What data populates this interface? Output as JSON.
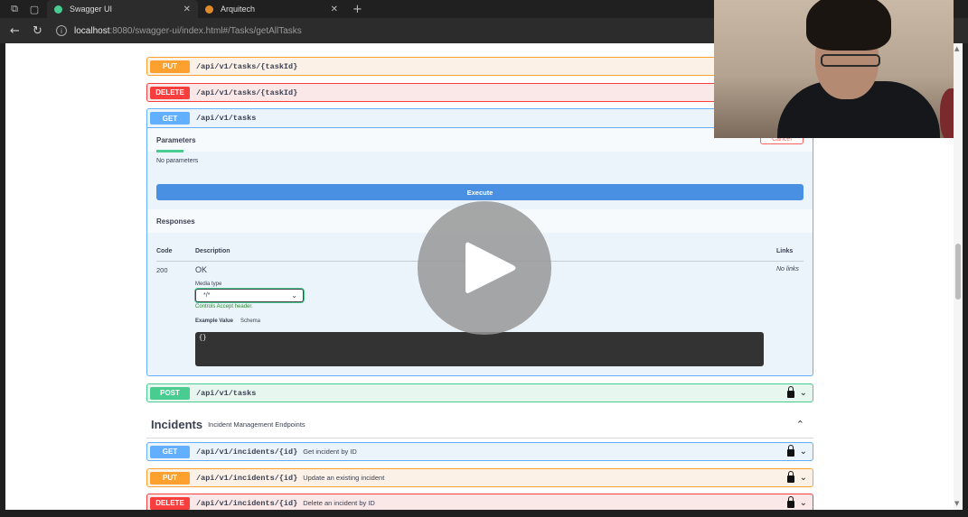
{
  "browser": {
    "tabs": [
      {
        "title": "Swagger UI",
        "active": true,
        "favicon_color": "#49cc90"
      },
      {
        "title": "Arquitech",
        "active": false,
        "favicon_color": "#e08a2a"
      }
    ],
    "url_host": "localhost",
    "url_rest": ":8080/swagger-ui/index.html#/Tasks/getAllTasks"
  },
  "operations_top": [
    {
      "method": "PUT",
      "path": "/api/v1/tasks/{taskId}"
    },
    {
      "method": "DELETE",
      "path": "/api/v1/tasks/{taskId}"
    }
  ],
  "get_expanded": {
    "method": "GET",
    "path": "/api/v1/tasks",
    "parameters_tab": "Parameters",
    "cancel_label": "Cancel",
    "no_params": "No parameters",
    "execute_label": "Execute",
    "responses_title": "Responses",
    "col_code": "Code",
    "col_description": "Description",
    "col_links": "Links",
    "response": {
      "code": "200",
      "description": "OK",
      "links": "No links",
      "media_type_label": "Media type",
      "media_type_value": "*/*",
      "controls_note": "Controls Accept header.",
      "example_value_tab": "Example Value",
      "schema_tab": "Schema",
      "example_body": "{}"
    }
  },
  "post_task": {
    "method": "POST",
    "path": "/api/v1/tasks"
  },
  "incidents": {
    "title": "Incidents",
    "description": "Incident Management Endpoints",
    "operations": [
      {
        "method": "GET",
        "path": "/api/v1/incidents/{id}",
        "summary": "Get incident by ID"
      },
      {
        "method": "PUT",
        "path": "/api/v1/incidents/{id}",
        "summary": "Update an existing incident"
      },
      {
        "method": "DELETE",
        "path": "/api/v1/incidents/{id}",
        "summary": "Delete an incident by ID"
      }
    ]
  },
  "icons": {
    "lock": "lock-icon",
    "chevron_down": "chevron-down-icon",
    "chevron_up": "chevron-up-icon",
    "play": "play-icon"
  },
  "colors": {
    "put": "#fca130",
    "delete": "#f93e3e",
    "get": "#61affe",
    "post": "#49cc90",
    "execute": "#4990e2"
  }
}
